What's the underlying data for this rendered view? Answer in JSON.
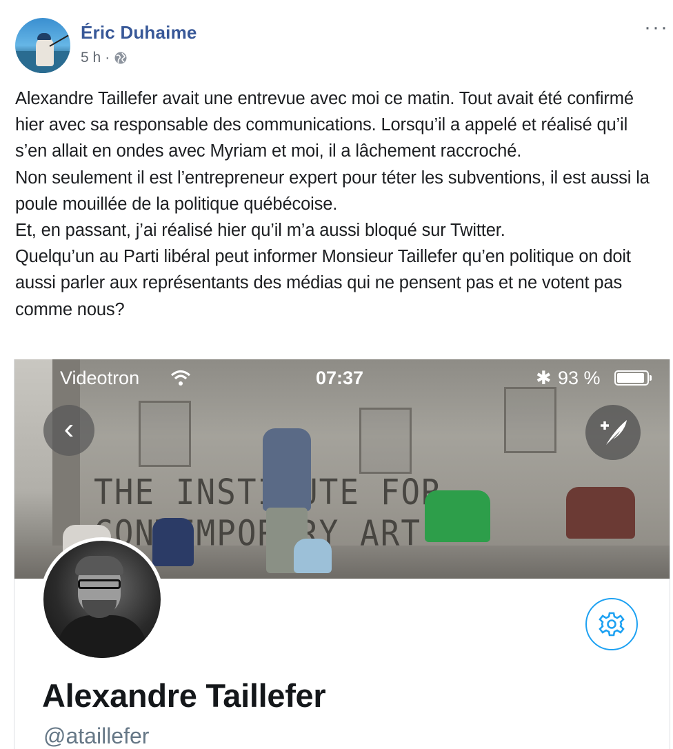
{
  "post": {
    "author": "Éric Duhaime",
    "time": "5 h",
    "separator": "·",
    "more_label": "···",
    "paragraphs": [
      "Alexandre Taillefer avait une entrevue avec moi ce matin. Tout avait été confirmé hier avec sa responsable des communications. Lorsqu’il a appelé et réalisé qu’il s’en allait en ondes avec Myriam et moi, il a lâchement raccroché.",
      "Non seulement il est l’entrepreneur expert pour téter les subventions, il est aussi la poule mouillée de la politique québécoise.",
      "Et, en passant, j’ai réalisé hier qu’il m’a aussi bloqué sur Twitter.",
      "Quelqu’un au Parti libéral peut informer Monsieur Taillefer qu’en politique on doit aussi parler aux représentants des médias qui ne pensent pas et ne votent pas comme nous?"
    ]
  },
  "screenshot": {
    "status_bar": {
      "carrier": "Videotron",
      "time": "07:37",
      "bluetooth": "✱",
      "battery_percent_label": "93 %",
      "battery_level": 0.93
    },
    "banner_text": "THE INSTITUTE FOR CONTEMPORARY ART",
    "back_label": "‹",
    "profile": {
      "name": "Alexandre Taillefer",
      "handle": "@ataillefer"
    }
  }
}
